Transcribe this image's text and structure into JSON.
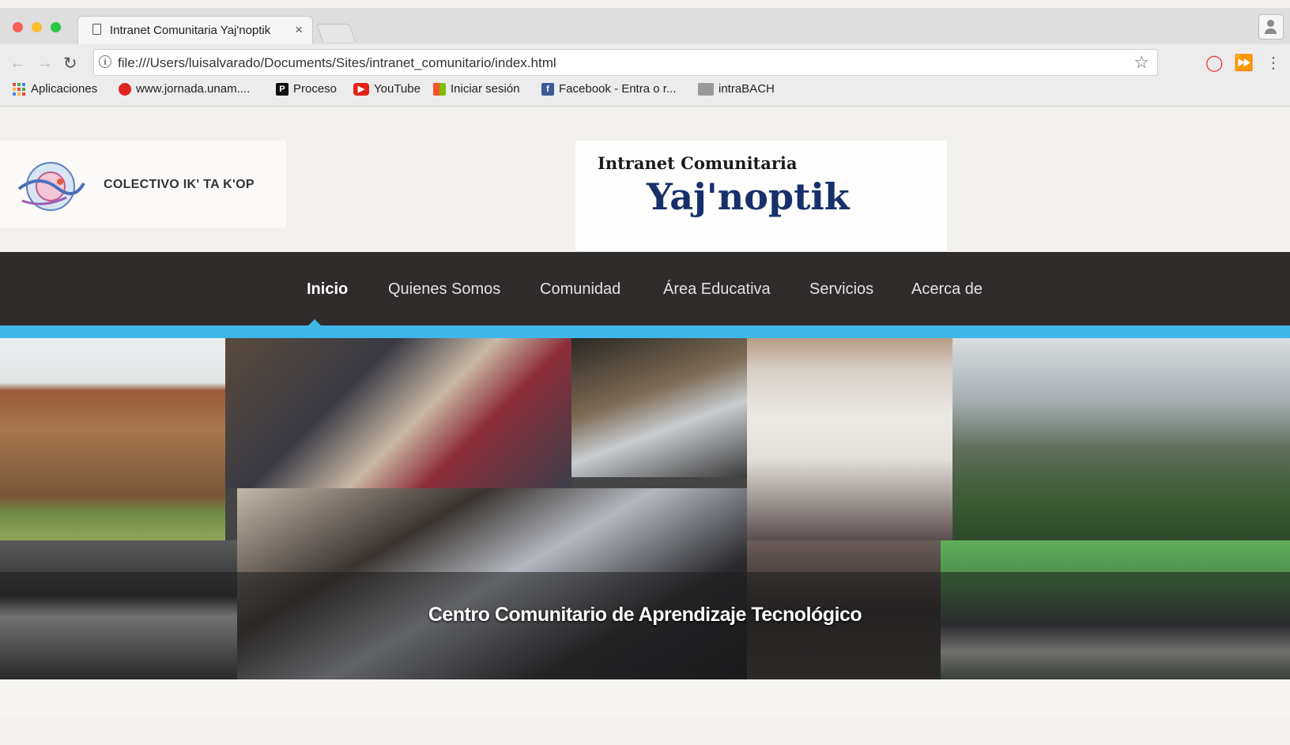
{
  "browser": {
    "tab_title": "Intranet Comunitaria Yaj'noptik",
    "tab_close": "×",
    "url": "file:///Users/luisalvarado/Documents/Sites/intranet_comunitario/index.html",
    "bookmarks": [
      {
        "label": "Aplicaciones",
        "icon": "apps-grid-icon"
      },
      {
        "label": "www.jornada.unam....",
        "icon": "jornada-icon"
      },
      {
        "label": "Proceso",
        "icon": "proceso-icon"
      },
      {
        "label": "YouTube",
        "icon": "youtube-icon"
      },
      {
        "label": "Iniciar sesión",
        "icon": "windows-icon"
      },
      {
        "label": "Facebook - Entra o r...",
        "icon": "facebook-icon"
      },
      {
        "label": "intraBACH",
        "icon": "intrabach-icon"
      }
    ],
    "colors": {
      "tab_bar": "#dedede",
      "toolbar": "#ececec"
    }
  },
  "site": {
    "collective_name": "COLECTIVO IK' TA K'OP",
    "logo_text": "Colectivo Ik' ta K'op",
    "header_line1": "Intranet Comunitaria",
    "header_line2": "Yaj'noptik",
    "nav": [
      {
        "label": "Inicio",
        "active": true
      },
      {
        "label": "Quienes Somos",
        "active": false
      },
      {
        "label": "Comunidad",
        "active": false
      },
      {
        "label": "Área Educativa",
        "active": false
      },
      {
        "label": "Servicios",
        "active": false
      },
      {
        "label": "Acerca de",
        "active": false
      }
    ],
    "hero_caption": "Centro Comunitario de Aprendizaje Tecnológico",
    "colors": {
      "nav_bg": "#2e2b2a",
      "accent": "#3fb7e6",
      "brand_blue": "#16306b"
    }
  }
}
